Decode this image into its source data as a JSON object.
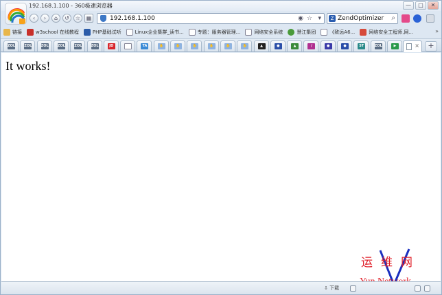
{
  "window": {
    "title": "192.168.1.100 - 360极速浏览器",
    "controls": {
      "minimize": "—",
      "maximize": "□",
      "close": "✕"
    }
  },
  "navbar": {
    "address": "192.168.1.100",
    "search_engine_label": "Z",
    "search_text": "ZendOptimizer",
    "icons": [
      "back-icon",
      "forward-icon",
      "home-icon",
      "undo-icon",
      "star-icon",
      "apps-icon"
    ]
  },
  "bookmarks": [
    {
      "label": "链接",
      "color": "#e8b64a"
    },
    {
      "label": "w3school 在线教程",
      "color": "#c8302b"
    },
    {
      "label": "PHP基础试听",
      "color": "#2c5ca8"
    },
    {
      "label": "Linux企业集群_读书...",
      "color": "#ffffff"
    },
    {
      "label": "专题：服务器管理...",
      "color": "#ffffff"
    },
    {
      "label": "网络安全系统",
      "color": "#ffffff"
    },
    {
      "label": "慧江集团",
      "color": "#4a9a3a"
    },
    {
      "label": "《致远A6...",
      "color": "#ffffff"
    },
    {
      "label": "网络安全工程师,网...",
      "color": "#d64a3a"
    }
  ],
  "bookmarks_more": "»",
  "tabs": {
    "mini_tabs": [
      {
        "label": "ZOL",
        "color": "#5a6d84"
      },
      {
        "label": "ZOL",
        "color": "#5a6d84"
      },
      {
        "label": "ZOL",
        "color": "#5a6d84"
      },
      {
        "label": "ZOL",
        "color": "#5a6d84"
      },
      {
        "label": "ZOL",
        "color": "#5a6d84"
      },
      {
        "label": "ZOL",
        "color": "#5a6d84"
      },
      {
        "label": "JD",
        "color": "#d8262c"
      },
      {
        "label": "",
        "color": "#ffffff"
      },
      {
        "label": "TA",
        "color": "#3a8ad6"
      },
      {
        "label": "✋",
        "color": "#8fb3e0"
      },
      {
        "label": "✋",
        "color": "#8fb3e0"
      },
      {
        "label": "✋",
        "color": "#8fb3e0"
      },
      {
        "label": "✋",
        "color": "#8fb3e0"
      },
      {
        "label": "✋",
        "color": "#8fb3e0"
      },
      {
        "label": "✋",
        "color": "#8fb3e0"
      },
      {
        "label": "▲",
        "color": "#222222"
      },
      {
        "label": "●",
        "color": "#2a4ea8"
      },
      {
        "label": "▲",
        "color": "#3a8a3a"
      },
      {
        "label": "/",
        "color": "#b03090"
      },
      {
        "label": "●",
        "color": "#3a3aa8"
      },
      {
        "label": "●",
        "color": "#2a4ea8"
      },
      {
        "label": "ST",
        "color": "#2a8a8a"
      },
      {
        "label": "ZOL",
        "color": "#5a6d84"
      },
      {
        "label": "▶",
        "color": "#2a9a4a"
      }
    ],
    "active_close": "×",
    "new_tab": "+"
  },
  "content": {
    "text": "It works!"
  },
  "watermark": {
    "chinese": "运维网",
    "english": "Yun Network"
  },
  "statusbar": {
    "download": "下载"
  }
}
